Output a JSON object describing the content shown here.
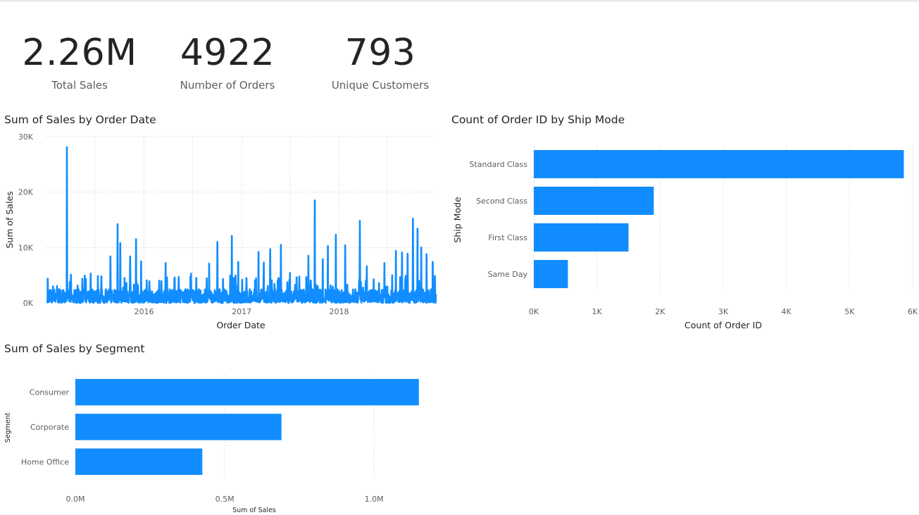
{
  "kpis": {
    "total_sales": {
      "value": "2.26M",
      "label": "Total Sales"
    },
    "orders": {
      "value": "4922",
      "label": "Number of Orders"
    },
    "customers": {
      "value": "793",
      "label": "Unique Customers"
    }
  },
  "colors": {
    "accent": "#118dff",
    "text": "#252423",
    "muted": "#605e5c"
  },
  "chart_data": [
    {
      "id": "sales_by_date",
      "type": "line",
      "title": "Sum of Sales by Order Date",
      "xlabel": "Order Date",
      "ylabel": "Sum of Sales",
      "x_range": [
        "2015-01-03",
        "2018-12-30"
      ],
      "x_ticks": [
        {
          "date": "2016-01-01",
          "label": "2016"
        },
        {
          "date": "2017-01-01",
          "label": "2017"
        },
        {
          "date": "2018-01-01",
          "label": "2018"
        }
      ],
      "ylim": [
        0,
        30000
      ],
      "y_ticks": [
        {
          "value": 0,
          "label": "0K"
        },
        {
          "value": 10000,
          "label": "10K"
        },
        {
          "value": 20000,
          "label": "20K"
        },
        {
          "value": 30000,
          "label": "30K"
        }
      ],
      "grid": true,
      "peaks": [
        {
          "date": "2015-01-05",
          "value": 4400
        },
        {
          "date": "2015-01-25",
          "value": 3000
        },
        {
          "date": "2015-03-18",
          "value": 28100
        },
        {
          "date": "2015-04-02",
          "value": 5100
        },
        {
          "date": "2015-06-15",
          "value": 5300
        },
        {
          "date": "2015-07-25",
          "value": 4800
        },
        {
          "date": "2015-08-28",
          "value": 8400
        },
        {
          "date": "2015-09-24",
          "value": 14200
        },
        {
          "date": "2015-10-04",
          "value": 10800
        },
        {
          "date": "2015-11-10",
          "value": 8400
        },
        {
          "date": "2015-12-02",
          "value": 11500
        },
        {
          "date": "2015-12-21",
          "value": 7500
        },
        {
          "date": "2016-03-22",
          "value": 7200
        },
        {
          "date": "2016-05-10",
          "value": 4700
        },
        {
          "date": "2016-06-25",
          "value": 5300
        },
        {
          "date": "2016-09-01",
          "value": 7100
        },
        {
          "date": "2016-10-02",
          "value": 11000
        },
        {
          "date": "2016-11-25",
          "value": 12100
        },
        {
          "date": "2016-12-19",
          "value": 7400
        },
        {
          "date": "2017-03-05",
          "value": 9200
        },
        {
          "date": "2017-03-25",
          "value": 7300
        },
        {
          "date": "2017-04-18",
          "value": 9700
        },
        {
          "date": "2017-05-28",
          "value": 10500
        },
        {
          "date": "2017-07-01",
          "value": 5400
        },
        {
          "date": "2017-09-08",
          "value": 8500
        },
        {
          "date": "2017-10-02",
          "value": 18500
        },
        {
          "date": "2017-11-01",
          "value": 7900
        },
        {
          "date": "2017-11-20",
          "value": 10300
        },
        {
          "date": "2017-12-20",
          "value": 12300
        },
        {
          "date": "2018-01-24",
          "value": 10400
        },
        {
          "date": "2018-03-20",
          "value": 14800
        },
        {
          "date": "2018-04-15",
          "value": 6600
        },
        {
          "date": "2018-06-20",
          "value": 7200
        },
        {
          "date": "2018-08-02",
          "value": 9400
        },
        {
          "date": "2018-08-25",
          "value": 9100
        },
        {
          "date": "2018-09-15",
          "value": 8900
        },
        {
          "date": "2018-10-05",
          "value": 15200
        },
        {
          "date": "2018-10-22",
          "value": 13400
        },
        {
          "date": "2018-11-05",
          "value": 10000
        },
        {
          "date": "2018-11-25",
          "value": 8800
        },
        {
          "date": "2018-12-18",
          "value": 7400
        }
      ]
    },
    {
      "id": "orders_by_ship_mode",
      "type": "bar",
      "orientation": "horizontal",
      "title": "Count of Order ID by Ship Mode",
      "xlabel": "Count of Order ID",
      "ylabel": "Ship Mode",
      "categories": [
        "Standard Class",
        "Second Class",
        "First Class",
        "Same Day"
      ],
      "values": [
        5860,
        1900,
        1500,
        540
      ],
      "xlim": [
        0,
        6000
      ],
      "x_ticks": [
        {
          "value": 0,
          "label": "0K"
        },
        {
          "value": 1000,
          "label": "1K"
        },
        {
          "value": 2000,
          "label": "2K"
        },
        {
          "value": 3000,
          "label": "3K"
        },
        {
          "value": 4000,
          "label": "4K"
        },
        {
          "value": 5000,
          "label": "5K"
        },
        {
          "value": 6000,
          "label": "6K"
        }
      ],
      "grid": true
    },
    {
      "id": "sales_by_segment",
      "type": "bar",
      "orientation": "horizontal",
      "title": "Sum of Sales by Segment",
      "xlabel": "Sum of Sales",
      "ylabel": "Segment",
      "categories": [
        "Consumer",
        "Corporate",
        "Home Office"
      ],
      "values": [
        1150000,
        690000,
        425000
      ],
      "xlim": [
        0,
        1200000
      ],
      "x_ticks": [
        {
          "value": 0,
          "label": "0.0M"
        },
        {
          "value": 500000,
          "label": "0.5M"
        },
        {
          "value": 1000000,
          "label": "1.0M"
        }
      ],
      "grid": true
    }
  ]
}
